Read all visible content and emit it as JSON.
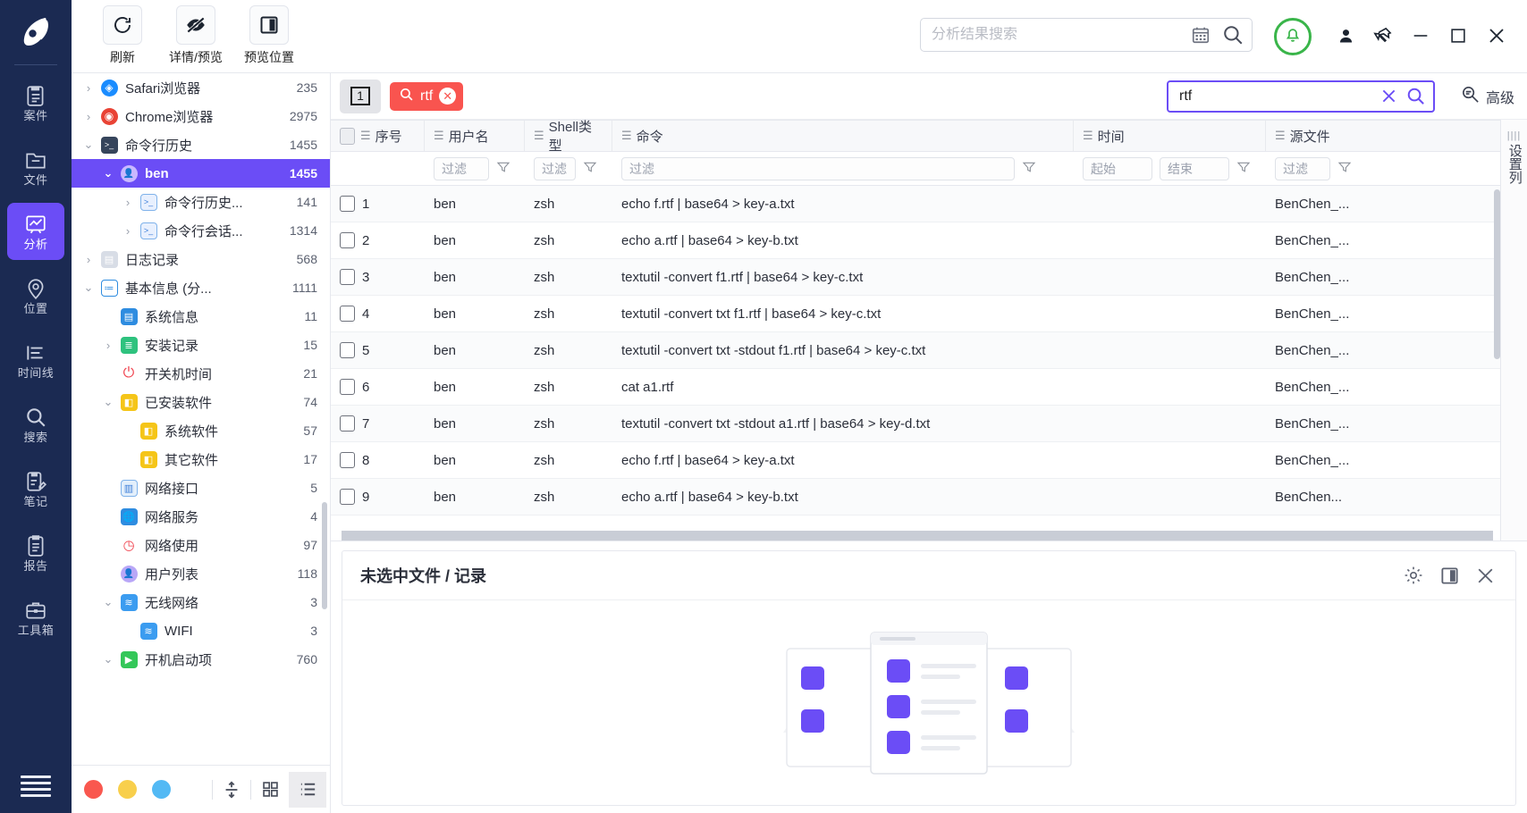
{
  "app": {
    "accent_purple": "#6b4df6",
    "rail_bg": "#1b2a52",
    "chip_red": "#f9544f",
    "bell_green": "#3ab54a"
  },
  "rail": {
    "items": [
      {
        "label": "案件",
        "icon": "case-clipboard-icon",
        "active": false
      },
      {
        "label": "文件",
        "icon": "folder-icon",
        "active": false
      },
      {
        "label": "分析",
        "icon": "analysis-chart-icon",
        "active": true
      },
      {
        "label": "位置",
        "icon": "location-pin-icon",
        "active": false
      },
      {
        "label": "时间线",
        "icon": "timeline-icon",
        "active": false
      },
      {
        "label": "搜索",
        "icon": "search-icon",
        "active": false
      },
      {
        "label": "笔记",
        "icon": "notes-pencil-icon",
        "active": false
      },
      {
        "label": "报告",
        "icon": "report-clipboard-icon",
        "active": false
      },
      {
        "label": "工具箱",
        "icon": "toolbox-icon",
        "active": false
      }
    ],
    "menu_icon": "hamburger-menu-icon"
  },
  "toolbar": {
    "buttons": [
      {
        "label": "刷新",
        "icon": "refresh-icon"
      },
      {
        "label": "详情/预览",
        "icon": "eye-slash-icon"
      },
      {
        "label": "预览位置",
        "icon": "panel-layout-icon"
      }
    ],
    "search": {
      "value": "",
      "placeholder": "分析结果搜索",
      "calendar_icon": "calendar-icon",
      "search_icon": "search-icon"
    },
    "notification_icon": "bell-icon",
    "user_icon": "user-icon",
    "pin_icon": "pin-icon",
    "minimize_icon": "minimize-icon",
    "maximize_icon": "maximize-icon",
    "close_icon": "close-icon"
  },
  "tree": {
    "items": [
      {
        "label": "Safari浏览器",
        "count": "235",
        "depth": 1,
        "chevron": "collapsed",
        "icon": "safari-icon",
        "selected": false
      },
      {
        "label": "Chrome浏览器",
        "count": "2975",
        "depth": 1,
        "chevron": "collapsed",
        "icon": "chrome-icon",
        "selected": false
      },
      {
        "label": "命令行历史",
        "count": "1455",
        "depth": 1,
        "chevron": "expanded",
        "icon": "terminal-dark-icon",
        "selected": false
      },
      {
        "label": "ben",
        "count": "1455",
        "depth": 2,
        "chevron": "expanded",
        "icon": "user-avatar-icon",
        "selected": true
      },
      {
        "label": "命令行历史...",
        "count": "141",
        "depth": 3,
        "chevron": "collapsed",
        "icon": "terminal-light-icon",
        "selected": false
      },
      {
        "label": "命令行会话...",
        "count": "1314",
        "depth": 3,
        "chevron": "collapsed",
        "icon": "terminal-light-icon",
        "selected": false
      },
      {
        "label": "日志记录",
        "count": "568",
        "depth": 1,
        "chevron": "collapsed",
        "icon": "log-file-icon",
        "selected": false
      },
      {
        "label": "基本信息 (分...",
        "count": "1111",
        "depth": 1,
        "chevron": "expanded",
        "icon": "list-info-icon",
        "selected": false
      },
      {
        "label": "系统信息",
        "count": "11",
        "depth": 2,
        "chevron": "none",
        "icon": "system-info-icon",
        "selected": false
      },
      {
        "label": "安装记录",
        "count": "15",
        "depth": 2,
        "chevron": "collapsed",
        "icon": "install-log-icon",
        "selected": false
      },
      {
        "label": "开关机时间",
        "count": "21",
        "depth": 2,
        "chevron": "none",
        "icon": "power-icon",
        "selected": false
      },
      {
        "label": "已安装软件",
        "count": "74",
        "depth": 2,
        "chevron": "expanded",
        "icon": "package-cube-icon",
        "selected": false
      },
      {
        "label": "系统软件",
        "count": "57",
        "depth": 3,
        "chevron": "none",
        "icon": "package-cube-icon",
        "selected": false
      },
      {
        "label": "其它软件",
        "count": "17",
        "depth": 3,
        "chevron": "none",
        "icon": "package-cube-icon",
        "selected": false
      },
      {
        "label": "网络接口",
        "count": "5",
        "depth": 2,
        "chevron": "none",
        "icon": "network-card-icon",
        "selected": false
      },
      {
        "label": "网络服务",
        "count": "4",
        "depth": 2,
        "chevron": "none",
        "icon": "globe-icon",
        "selected": false
      },
      {
        "label": "网络使用",
        "count": "97",
        "depth": 2,
        "chevron": "none",
        "icon": "network-usage-icon",
        "selected": false
      },
      {
        "label": "用户列表",
        "count": "118",
        "depth": 2,
        "chevron": "none",
        "icon": "users-icon",
        "selected": false
      },
      {
        "label": "无线网络",
        "count": "3",
        "depth": 2,
        "chevron": "expanded",
        "icon": "wifi-icon",
        "selected": false
      },
      {
        "label": "WIFI",
        "count": "3",
        "depth": 3,
        "chevron": "none",
        "icon": "wifi-icon",
        "selected": false
      },
      {
        "label": "开机启动项",
        "count": "760",
        "depth": 2,
        "chevron": "expanded",
        "icon": "startup-play-icon",
        "selected": false
      }
    ],
    "footer": {
      "dots": [
        "#f9584f",
        "#f8cf4c",
        "#53b9f4"
      ],
      "buttons": [
        {
          "icon": "expand-collapse-icon",
          "active": false
        },
        {
          "icon": "grid-view-icon",
          "active": false
        },
        {
          "icon": "list-view-icon",
          "active": true
        }
      ]
    }
  },
  "filterbar": {
    "count_badge": "1",
    "chip": {
      "icon": "search-icon",
      "label": "rtf",
      "close_icon": "close-circle-icon"
    },
    "result_search": {
      "value": "rtf",
      "clear_icon": "clear-x-icon",
      "search_icon": "search-icon"
    },
    "advanced": {
      "label": "高级",
      "icon": "advanced-search-icon"
    }
  },
  "table": {
    "columns": [
      {
        "key": "no",
        "label": "序号"
      },
      {
        "key": "user",
        "label": "用户名"
      },
      {
        "key": "shell",
        "label": "Shell类型"
      },
      {
        "key": "cmd",
        "label": "命令"
      },
      {
        "key": "time",
        "label": "时间"
      },
      {
        "key": "src",
        "label": "源文件"
      }
    ],
    "filters": {
      "user": "过滤",
      "shell": "过滤",
      "cmd": "过滤",
      "time_start": "起始",
      "time_end": "结束",
      "src": "过滤"
    },
    "rows": [
      {
        "no": "1",
        "user": "ben",
        "shell": "zsh",
        "cmd": "echo f.rtf | base64 > key-a.txt",
        "time": "",
        "src": "BenChen_..."
      },
      {
        "no": "2",
        "user": "ben",
        "shell": "zsh",
        "cmd": "echo a.rtf | base64 > key-b.txt",
        "time": "",
        "src": "BenChen_..."
      },
      {
        "no": "3",
        "user": "ben",
        "shell": "zsh",
        "cmd": "textutil -convert f1.rtf | base64 > key-c.txt",
        "time": "",
        "src": "BenChen_..."
      },
      {
        "no": "4",
        "user": "ben",
        "shell": "zsh",
        "cmd": "textutil -convert txt f1.rtf | base64 > key-c.txt",
        "time": "",
        "src": "BenChen_..."
      },
      {
        "no": "5",
        "user": "ben",
        "shell": "zsh",
        "cmd": "textutil -convert txt -stdout f1.rtf | base64 > key-c.txt",
        "time": "",
        "src": "BenChen_..."
      },
      {
        "no": "6",
        "user": "ben",
        "shell": "zsh",
        "cmd": "cat a1.rtf",
        "time": "",
        "src": "BenChen_..."
      },
      {
        "no": "7",
        "user": "ben",
        "shell": "zsh",
        "cmd": "textutil -convert txt -stdout a1.rtf | base64 > key-d.txt",
        "time": "",
        "src": "BenChen_..."
      },
      {
        "no": "8",
        "user": "ben",
        "shell": "zsh",
        "cmd": "echo f.rtf | base64 > key-a.txt",
        "time": "",
        "src": "BenChen_..."
      },
      {
        "no": "9",
        "user": "ben",
        "shell": "zsh",
        "cmd": "echo a.rtf | base64 > key-b.txt",
        "time": "",
        "src": "BenChen..."
      }
    ],
    "settings_strip": {
      "label": "设置列",
      "grip_icon": "drag-grip-icon"
    }
  },
  "preview": {
    "title": "未选中文件 / 记录",
    "gear_icon": "gear-icon",
    "panel_icon": "panel-layout-icon",
    "close_icon": "close-icon",
    "empty_illustration": "empty-state-illustration"
  }
}
